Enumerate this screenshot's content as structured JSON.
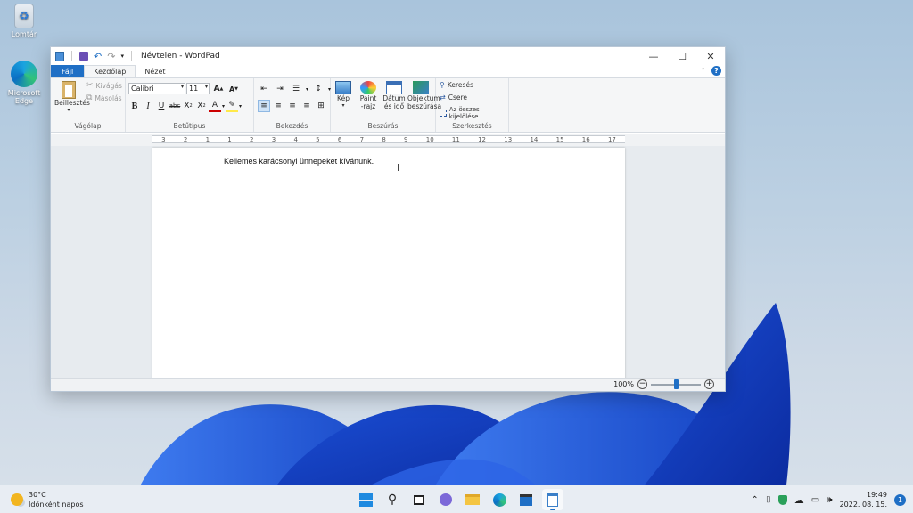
{
  "desktop": {
    "icons": [
      {
        "label": "Lomtár",
        "icon": "recycle-bin-icon"
      },
      {
        "label": "Microsoft Edge",
        "icon": "edge-icon"
      }
    ]
  },
  "window": {
    "title": "Névtelen - WordPad",
    "controls": {
      "minimize": "—",
      "maximize": "☐",
      "close": "✕"
    }
  },
  "tabs": [
    {
      "label": "Fájl"
    },
    {
      "label": "Kezdőlap"
    },
    {
      "label": "Nézet"
    }
  ],
  "ribbon": {
    "clipboard": {
      "paste": "Beillesztés",
      "cut": "Kivágás",
      "copy": "Másolás",
      "label": "Vágólap"
    },
    "font": {
      "name": "Calibri",
      "size": "11",
      "label": "Betűtípus"
    },
    "paragraph": {
      "label": "Bekezdés"
    },
    "insert": {
      "picture": "Kép",
      "paint": "Paint",
      "paint2": "-rajz",
      "date": "Dátum",
      "date2": "és idő",
      "object": "Objektum",
      "object2": "beszúrása",
      "label": "Beszúrás"
    },
    "editing": {
      "find": "Keresés",
      "replace": "Csere",
      "select_all": "Az összes kijelölése",
      "label": "Szerkesztés"
    }
  },
  "ruler": [
    "3",
    "2",
    "1",
    "1",
    "2",
    "3",
    "4",
    "5",
    "6",
    "7",
    "8",
    "9",
    "10",
    "11",
    "12",
    "13",
    "14",
    "15",
    "16",
    "17"
  ],
  "document": {
    "text": "Kellemes karácsonyi ünnepeket kívánunk."
  },
  "status": {
    "zoom": "100%",
    "zoom_level": 0.5
  },
  "taskbar": {
    "weather": {
      "temp": "30°C",
      "desc": "Időnként napos"
    },
    "clock": {
      "time": "19:49",
      "date": "2022. 08. 15."
    },
    "notifications": "1"
  },
  "colors": {
    "accent": "#1f6fc5"
  }
}
